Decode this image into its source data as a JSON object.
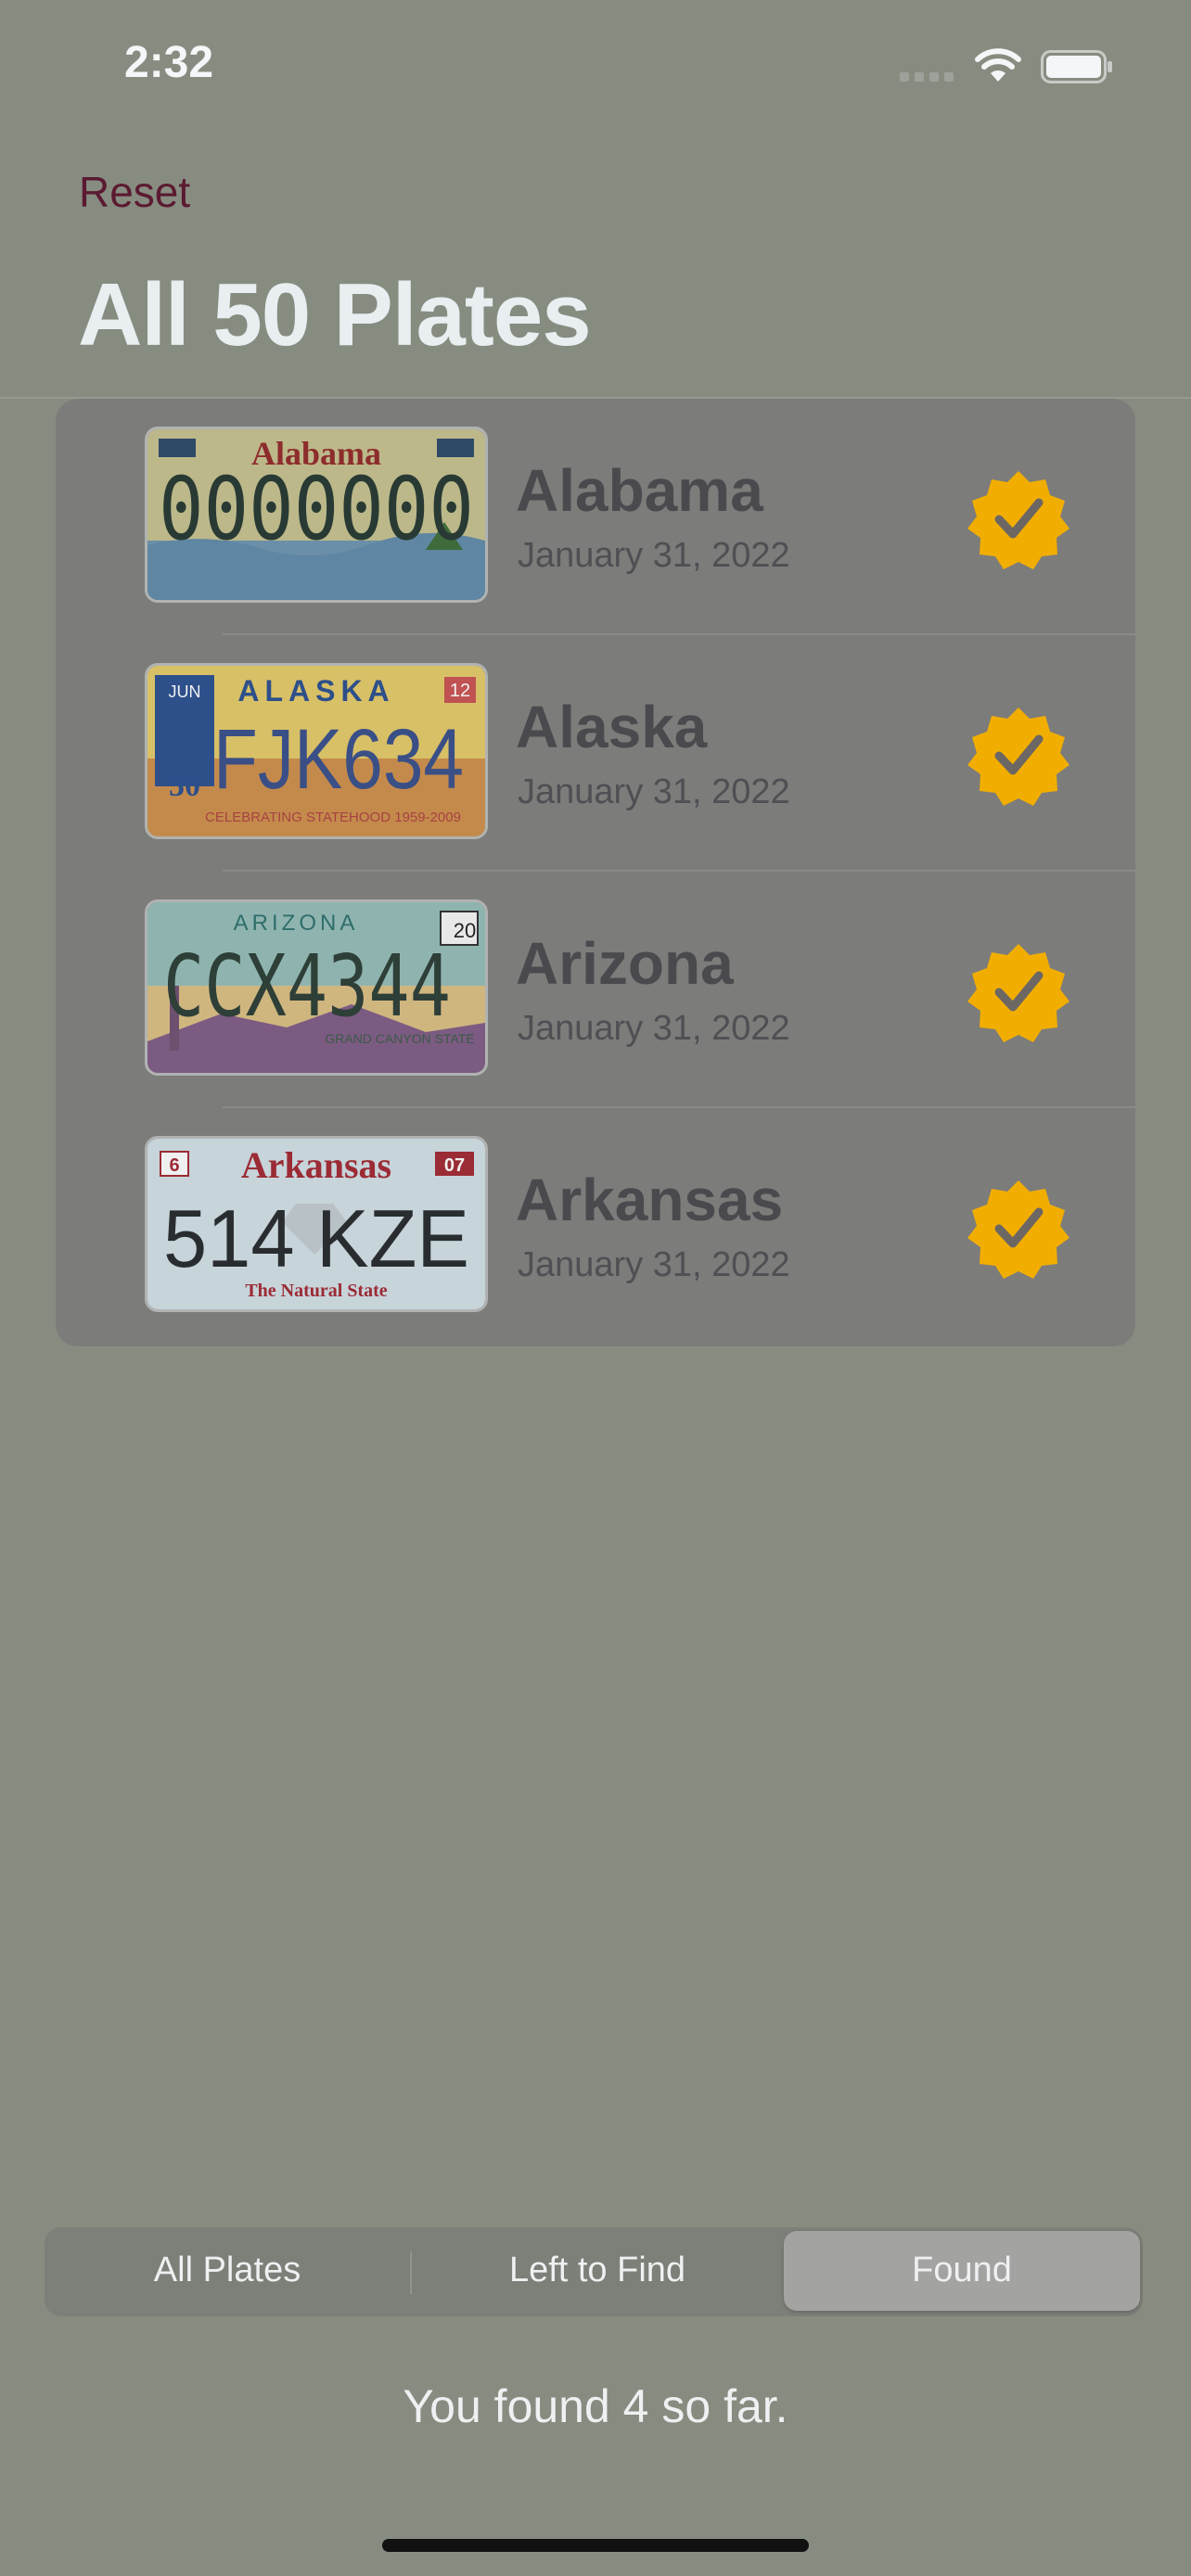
{
  "status_bar": {
    "time": "2:32"
  },
  "nav": {
    "reset_label": "Reset",
    "title": "All 50 Plates"
  },
  "plates": [
    {
      "state": "Alabama",
      "date": "January 31, 2022",
      "plate_text": "0000000",
      "header": "Alabama"
    },
    {
      "state": "Alaska",
      "date": "January 31, 2022",
      "plate_text": "FJK634",
      "header": "ALASKA",
      "month": "JUN",
      "year": "12",
      "footer": "CELEBRATING STATEHOOD 1959-2009"
    },
    {
      "state": "Arizona",
      "date": "January 31, 2022",
      "plate_text": "CCX4344",
      "header": "ARIZONA",
      "year": "20",
      "footer": "GRAND CANYON STATE"
    },
    {
      "state": "Arkansas",
      "date": "January 31, 2022",
      "plate_text": "514 KZE",
      "header": "Arkansas",
      "month": "6",
      "year": "07",
      "footer": "The Natural State"
    }
  ],
  "tabs": {
    "all": "All Plates",
    "left": "Left to Find",
    "found": "Found",
    "selected": "Found"
  },
  "footer": {
    "count_text": "You found 4 so far."
  },
  "colors": {
    "background": "#878c81",
    "badge": "#f2ae00",
    "reset": "#5b1a31"
  },
  "icons": {
    "badge": "checkmark-seal-icon",
    "wifi": "wifi-icon",
    "battery": "battery-icon"
  }
}
